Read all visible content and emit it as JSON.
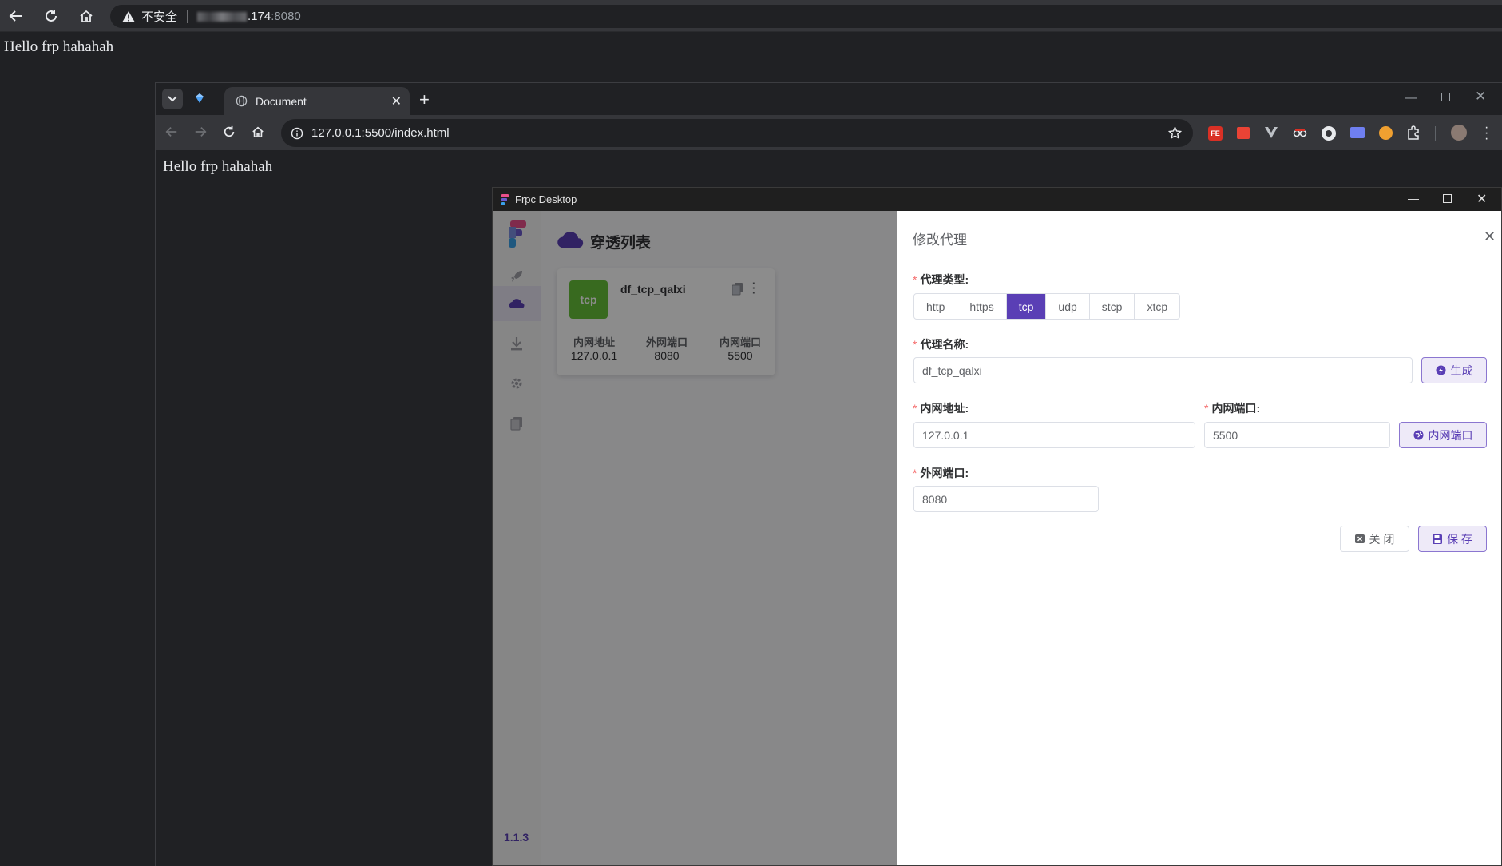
{
  "outer_browser": {
    "security_label": "不安全",
    "url_host_suffix": ".174",
    "url_port": ":8080",
    "page_text": "Hello frp hahahah"
  },
  "inner_browser": {
    "tab_title": "Document",
    "url": "127.0.0.1:5500/index.html",
    "page_text": "Hello frp hahahah"
  },
  "frpc": {
    "window_title": "Frpc Desktop",
    "version": "1.1.3",
    "main": {
      "heading": "穿透列表",
      "card": {
        "type_badge": "tcp",
        "name": "df_tcp_qalxi",
        "columns": [
          {
            "header": "内网地址",
            "value": "127.0.0.1"
          },
          {
            "header": "外网端口",
            "value": "8080"
          },
          {
            "header": "内网端口",
            "value": "5500"
          }
        ]
      }
    },
    "drawer": {
      "title": "修改代理",
      "proxy_type_label": "代理类型:",
      "proxy_types": [
        "http",
        "https",
        "tcp",
        "udp",
        "stcp",
        "xtcp"
      ],
      "proxy_type_selected": "tcp",
      "proxy_name_label": "代理名称:",
      "proxy_name_value": "df_tcp_qalxi",
      "generate_button": "生成",
      "local_ip_label": "内网地址:",
      "local_ip_value": "127.0.0.1",
      "local_port_label": "内网端口:",
      "local_port_value": "5500",
      "local_port_button": "内网端口",
      "remote_port_label": "外网端口:",
      "remote_port_value": "8080",
      "close_button": "关 闭",
      "save_button": "保 存"
    }
  },
  "colors": {
    "accent": "#5a3fb5",
    "tcp_badge": "#67c23a",
    "required": "#f56c6c"
  }
}
